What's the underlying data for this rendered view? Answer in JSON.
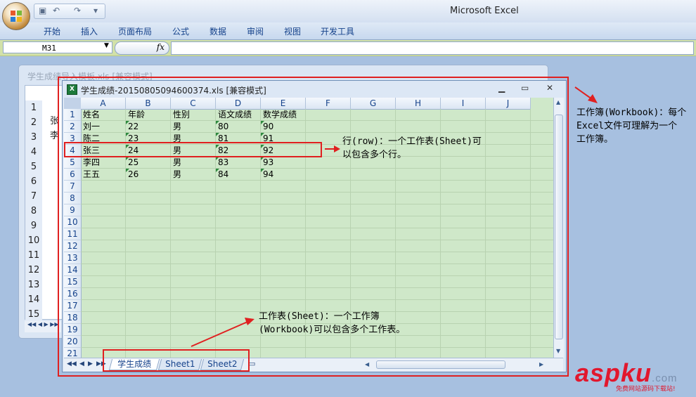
{
  "app": {
    "title": "Microsoft Excel"
  },
  "ribbon": {
    "tabs": [
      "开始",
      "插入",
      "页面布局",
      "公式",
      "数据",
      "审阅",
      "视图",
      "开发工具"
    ]
  },
  "formula_bar": {
    "name_box": "M31",
    "fx": "fx",
    "formula": ""
  },
  "bg_window": {
    "title": "学生成绩导入模板.xls  [兼容模式]",
    "rows": [
      "1",
      "2",
      "3",
      "4",
      "5",
      "6",
      "7",
      "8",
      "9",
      "10",
      "11",
      "12",
      "13",
      "14",
      "15"
    ],
    "cells": [
      "张",
      "李"
    ]
  },
  "workbook": {
    "title": "学生成绩-20150805094600374.xls  [兼容模式]",
    "icon": "excel-file-icon",
    "columns": [
      "A",
      "B",
      "C",
      "D",
      "E",
      "F",
      "G",
      "H",
      "I",
      "J"
    ],
    "rows": [
      "1",
      "2",
      "3",
      "4",
      "5",
      "6",
      "7",
      "8",
      "9",
      "10",
      "11",
      "12",
      "13",
      "14",
      "15",
      "16",
      "17",
      "18",
      "19",
      "20",
      "21"
    ],
    "table": [
      [
        "姓名",
        "年龄",
        "性别",
        "语文成绩",
        "数学成绩"
      ],
      [
        "刘一",
        "22",
        "男",
        "80",
        "90"
      ],
      [
        "陈二",
        "23",
        "男",
        "81",
        "91"
      ],
      [
        "张三",
        "24",
        "男",
        "82",
        "92"
      ],
      [
        "李四",
        "25",
        "男",
        "83",
        "93"
      ],
      [
        "王五",
        "26",
        "男",
        "84",
        "94"
      ]
    ],
    "sheet_tabs": [
      "学生成绩",
      "Sheet1",
      "Sheet2"
    ],
    "active_sheet": "学生成绩"
  },
  "annotations": {
    "workbook": [
      "工作簿(Workbook)：每个",
      "Excel文件可理解为一个",
      "工作簿。"
    ],
    "row": [
      "行(row)：一个工作表(Sheet)可",
      "以包含多个行。"
    ],
    "sheet": [
      "工作表(Sheet)：一个工作簿",
      "(Workbook)可以包含多个工作表。"
    ]
  },
  "watermark": {
    "brand": "aspku",
    "tld": ".com",
    "sub": "免费网站源码下载站!"
  },
  "colors": {
    "highlight": "#e02020",
    "grid_bg": "#cfe8c9",
    "ribbon_text": "#15428b"
  }
}
